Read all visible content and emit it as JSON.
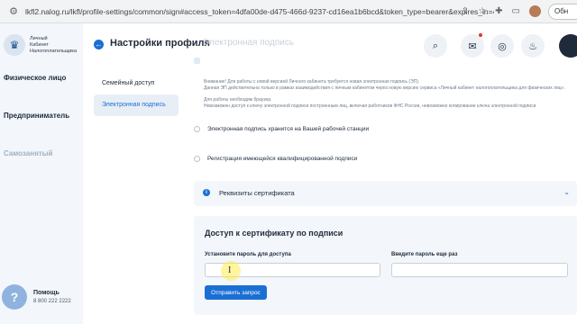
{
  "browser": {
    "url": "lkfl2.nalog.ru/lkfl/profile-settings/common/sign#access_token=4dfa00de-d475-466d-9237-cd16ea1b6bcd&token_type=bearer&expires_in=43199&scope=read%20%20...",
    "pill_label": "Обн"
  },
  "sidebar": {
    "logo_text": [
      "Личный",
      "Кабинет",
      "Налогоплательщика"
    ],
    "items": [
      {
        "label": "Физическое лицо"
      },
      {
        "label": "Предприниматель"
      },
      {
        "label": "Самозанятый"
      }
    ],
    "help": {
      "title": "Помощь",
      "phone": "8 800 222 2222",
      "icon": "?"
    }
  },
  "header": {
    "title": "Настройки профиля",
    "faded": "Электронная подпись"
  },
  "header_buttons": [
    "search-icon",
    "mail-icon",
    "eye-off-icon",
    "lightbulb-icon"
  ],
  "menu": {
    "items": [
      {
        "label": "Семейный доступ"
      },
      {
        "label": "Электронная подпись"
      }
    ]
  },
  "notes": {
    "line1": "Внимание! Для работы с новой версией Личного кабинета требуется новая электронная подпись (ЭП).",
    "line2": "Данная ЭП действительна только в рамках взаимодействия с личным кабинетом через новую версию сервиса «Личный кабинет налогоплательщика для физических лиц».",
    "line3": "Для работы необходим браузер.",
    "line4": "Невозможен доступ к ключу электронной подписи построенным лиц, включая работников ФНС России, невозможно копирование ключа электронной подписи"
  },
  "options": [
    {
      "label": "Электронная подпись хранится на Вашей рабочей станции"
    },
    {
      "label": "Регистрация имеющейся квалифицированной подписи"
    }
  ],
  "accordion": {
    "title": "Реквизиты сертификата"
  },
  "access": {
    "title": "Доступ к сертификату по подписи",
    "password_label": "Установите пароль для доступа",
    "password_value": "",
    "confirm_label": "Введите пароль еще раз",
    "confirm_value": "",
    "submit_label": "Отправить запрос"
  }
}
